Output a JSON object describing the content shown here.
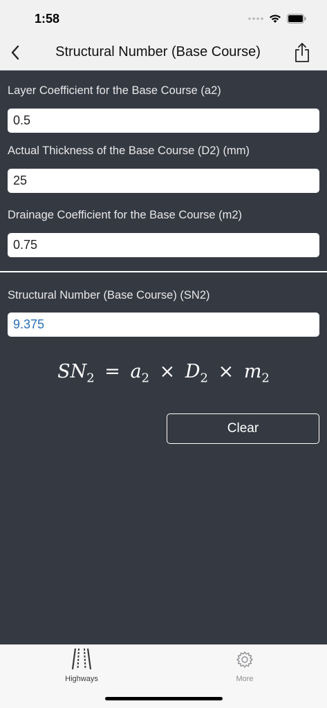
{
  "status_bar": {
    "time": "1:58"
  },
  "nav": {
    "title": "Structural Number (Base Course)"
  },
  "fields": [
    {
      "label": "Layer Coefficient for the Base Course (a2)",
      "value": "0.5"
    },
    {
      "label": "Actual Thickness of the Base Course (D2) (mm)",
      "value": "25"
    },
    {
      "label": "Drainage Coefficient for the Base Course (m2)",
      "value": "0.75"
    }
  ],
  "result": {
    "label": "Structural Number (Base Course) (SN2)",
    "value": "9.375"
  },
  "formula": {
    "lhs": "SN",
    "lhs_sub": "2",
    "equals": "=",
    "a": "a",
    "a_sub": "2",
    "times1": "×",
    "d": "D",
    "d_sub": "2",
    "times2": "×",
    "m": "m",
    "m_sub": "2"
  },
  "actions": {
    "clear_label": "Clear"
  },
  "tabs": [
    {
      "label": "Highways",
      "icon": "road-icon",
      "active": true
    },
    {
      "label": "More",
      "icon": "gear-icon",
      "active": false
    }
  ],
  "colors": {
    "background": "#353942",
    "bars": "#f1f1f2",
    "result_text": "#2a6fb9",
    "tab_active": "#3a3a3c",
    "tab_inactive": "#8e8e93"
  }
}
